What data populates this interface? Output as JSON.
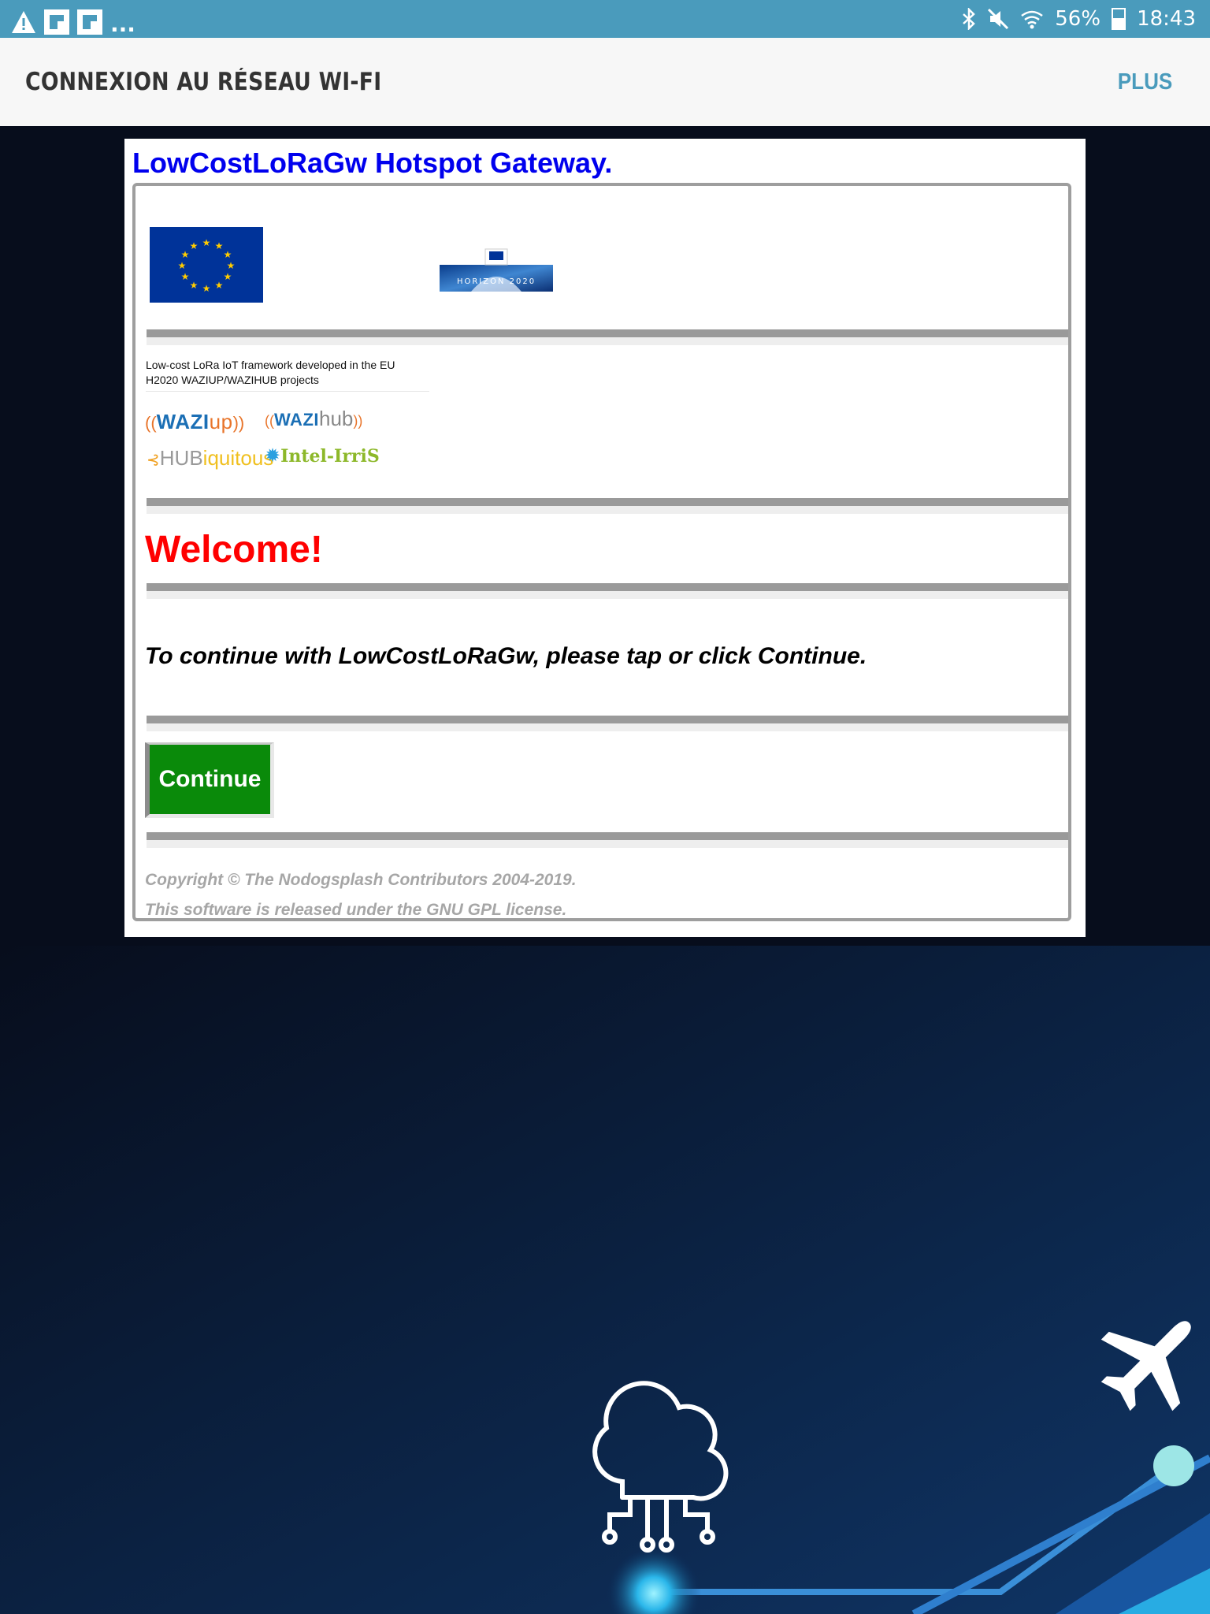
{
  "status_bar": {
    "more_notifications": "...",
    "battery_percent": "56%",
    "time": "18:43",
    "icons": [
      "warning-icon",
      "notification-icon",
      "notification-icon",
      "bluetooth-icon",
      "mute-icon",
      "wifi-icon",
      "battery-icon"
    ]
  },
  "app_bar": {
    "title": "CONNEXION AU RÉSEAU WI-FI",
    "more_label": "PLUS"
  },
  "portal": {
    "title": "LowCostLoRaGw Hotspot Gateway.",
    "horizon_label": "HORIZON 2020",
    "tagline": "Low-cost LoRa IoT framework developed in the EU H2020 WAZIUP/WAZIHUB projects",
    "partners": {
      "waziup_a": "WAZI",
      "waziup_b": "up",
      "wazihub_a": "WAZI",
      "wazihub_b": "hub",
      "hubiquitous_a": "HUB",
      "hubiquitous_b": "iquitous",
      "intel_irris": "Intel-IrriS"
    },
    "welcome": "Welcome!",
    "instruction": "To continue with LowCostLoRaGw, please tap or click Continue.",
    "continue_label": "Continue",
    "copyright": "Copyright © The Nodogsplash Contributors 2004-2019.",
    "license": "This software is released under the GNU GPL license."
  },
  "colors": {
    "status_bar": "#4a9bbc",
    "title_link": "#0000ee",
    "welcome": "#ff0000",
    "continue_button": "#0a8a0a",
    "background": "#070d1c"
  }
}
